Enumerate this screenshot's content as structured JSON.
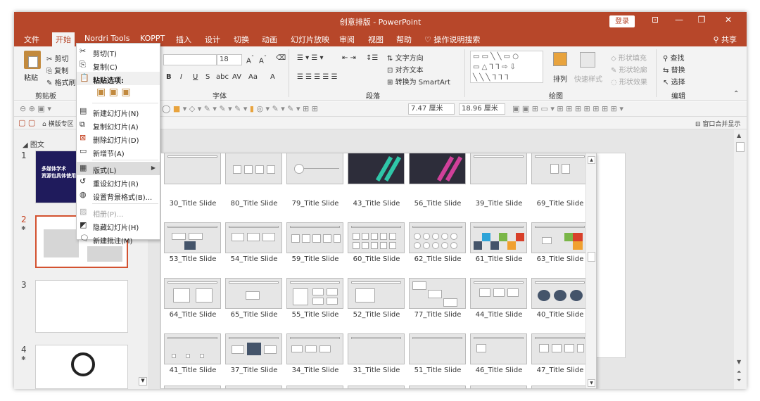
{
  "window": {
    "title": "创意排版 - PowerPoint",
    "login_label": "登录",
    "share_label": "共享"
  },
  "menu_tabs": [
    "文件",
    "开始",
    "Nordri Tools",
    "KOPPT",
    "插入",
    "设计",
    "切换",
    "动画",
    "幻灯片放映",
    "审阅",
    "视图",
    "帮助"
  ],
  "tell_me": "操作说明搜索",
  "ribbon": {
    "clipboard": {
      "paste": "粘贴",
      "cut": "剪切",
      "copy": "复制",
      "format_painter": "格式刷",
      "group": "剪贴板"
    },
    "font": {
      "size": "18",
      "group": "字体",
      "clear": "Aa"
    },
    "paragraph": {
      "text_direction": "文字方向",
      "align_text": "对齐文本",
      "smartart": "转换为 SmartArt",
      "group": "段落"
    },
    "drawing": {
      "arrange": "排列",
      "quick_styles": "快速样式",
      "shape_fill": "形状填充",
      "shape_outline": "形状轮廓",
      "shape_effects": "形状效果",
      "group": "绘图"
    },
    "editing": {
      "find": "查找",
      "replace": "替换",
      "select": "选择",
      "group": "编辑"
    }
  },
  "toolbar2": {
    "width": "7.47 厘米",
    "height": "18.96 厘米"
  },
  "toolbar3": {
    "tab_label": "横版专区",
    "window_label": "窗口合并显示"
  },
  "thumb_pane": {
    "section": "图文",
    "slide1_title": "多媒体学术",
    "slide1_sub": "资源包具体使用",
    "numbers": [
      "1",
      "2",
      "3",
      "4"
    ]
  },
  "context_menu": {
    "items": [
      {
        "label": "剪切(T)",
        "icon": "scissors-icon",
        "enabled": true
      },
      {
        "label": "复制(C)",
        "icon": "copy-icon",
        "enabled": true
      },
      {
        "label": "粘贴选项:",
        "icon": "paste-icon",
        "enabled": true,
        "header": true
      },
      {
        "label": "新建幻灯片(N)",
        "icon": "new-slide-icon",
        "enabled": true
      },
      {
        "label": "复制幻灯片(A)",
        "icon": "duplicate-slide-icon",
        "enabled": true
      },
      {
        "label": "删除幻灯片(D)",
        "icon": "delete-slide-icon",
        "enabled": true
      },
      {
        "label": "新增节(A)",
        "icon": "section-icon",
        "enabled": true
      },
      {
        "label": "版式(L)",
        "icon": "layout-icon",
        "enabled": true,
        "submenu": true,
        "highlighted": true
      },
      {
        "label": "重设幻灯片(R)",
        "icon": "reset-icon",
        "enabled": true
      },
      {
        "label": "设置背景格式(B)...",
        "icon": "background-icon",
        "enabled": true
      },
      {
        "label": "相册(P)...",
        "icon": "album-icon",
        "enabled": false
      },
      {
        "label": "隐藏幻灯片(H)",
        "icon": "hide-icon",
        "enabled": true
      },
      {
        "label": "新建批注(M)",
        "icon": "comment-icon",
        "enabled": true
      }
    ]
  },
  "layouts": [
    [
      "30_Title Slide",
      "80_Title Slide",
      "79_Title Slide",
      "43_Title Slide",
      "56_Title Slide",
      "39_Title Slide",
      "69_Title Slide"
    ],
    [
      "53_Title Slide",
      "54_Title Slide",
      "59_Title Slide",
      "60_Title Slide",
      "62_Title Slide",
      "61_Title Slide",
      "63_Title Slide"
    ],
    [
      "64_Title Slide",
      "65_Title Slide",
      "55_Title Slide",
      "52_Title Slide",
      "77_Title Slide",
      "44_Title Slide",
      "40_Title Slide"
    ],
    [
      "41_Title Slide",
      "37_Title Slide",
      "34_Title Slide",
      "31_Title Slide",
      "51_Title Slide",
      "46_Title Slide",
      "47_Title Slide"
    ]
  ],
  "colors": {
    "accent": "#b7472a",
    "selected_border": "#d35230"
  }
}
